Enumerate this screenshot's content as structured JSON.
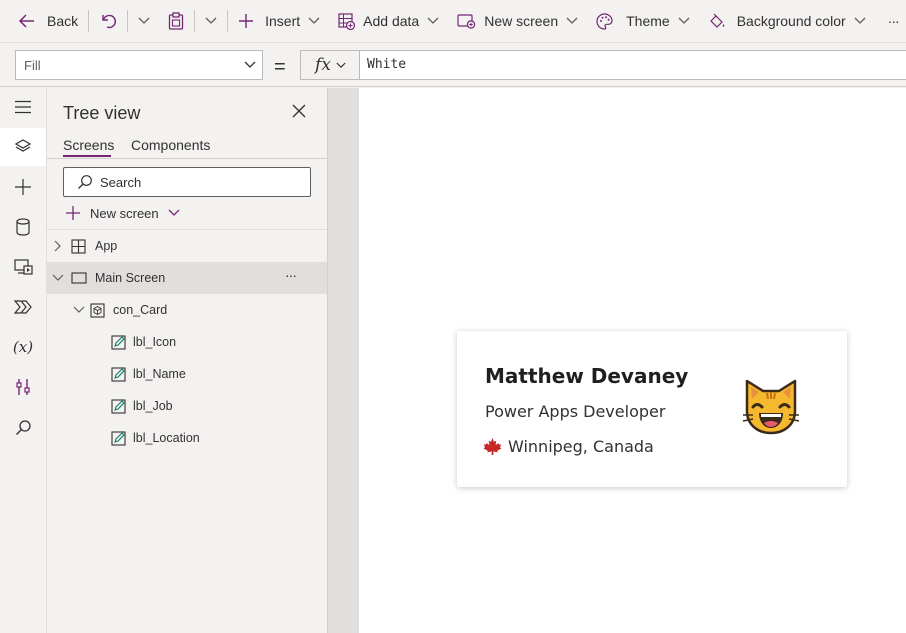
{
  "toolbar": {
    "back_label": "Back",
    "insert_label": "Insert",
    "add_data_label": "Add data",
    "new_screen_label": "New screen",
    "theme_label": "Theme",
    "background_color_label": "Background color",
    "more_label": "···"
  },
  "formula_bar": {
    "property": "Fill",
    "equals": "=",
    "fx": "fx",
    "value": "White"
  },
  "tree_view": {
    "title": "Tree view",
    "tabs": [
      "Screens",
      "Components"
    ],
    "search_placeholder": "Search",
    "new_screen_label": "New screen",
    "nodes": [
      {
        "label": "App",
        "type": "app"
      },
      {
        "label": "Main Screen",
        "type": "screen",
        "more": "···"
      },
      {
        "label": "con_Card",
        "type": "container"
      },
      {
        "label": "lbl_Icon",
        "type": "label"
      },
      {
        "label": "lbl_Name",
        "type": "label"
      },
      {
        "label": "lbl_Job",
        "type": "label"
      },
      {
        "label": "lbl_Location",
        "type": "label"
      }
    ]
  },
  "card": {
    "name": "Matthew Devaney",
    "job": "Power Apps Developer",
    "location": "Winnipeg, Canada",
    "location_icon": "maple-leaf",
    "avatar_icon": "cat-face-emoji"
  },
  "colors": {
    "accent": "#742774",
    "canvas_bg": "#ffffff",
    "chrome_bg": "#f3f2f1"
  }
}
